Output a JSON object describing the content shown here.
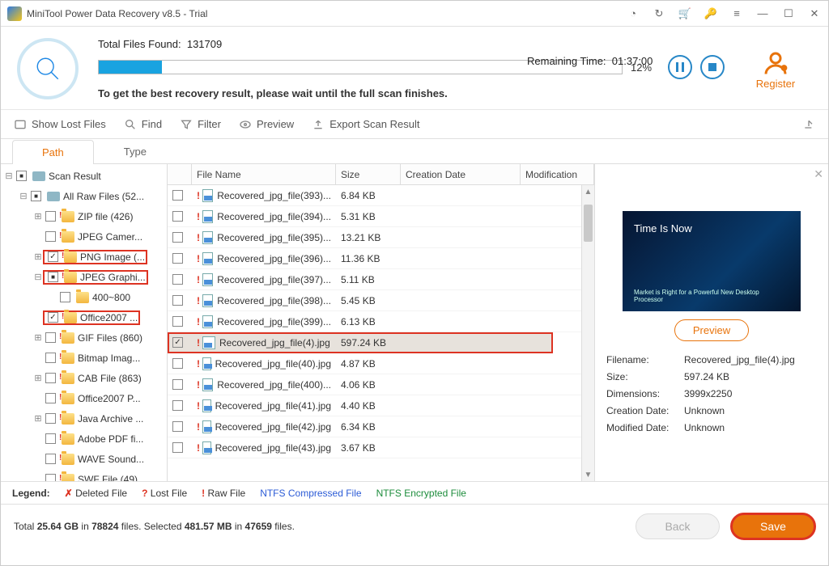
{
  "title": "MiniTool Power Data Recovery v8.5 - Trial",
  "scan": {
    "found_label": "Total Files Found:",
    "found_value": "131709",
    "remaining_label": "Remaining Time:",
    "remaining_value": "01:37:00",
    "percent": "12%",
    "hint_prefix": "To get the best recovery result, please wait until the full scan finishes."
  },
  "register_label": "Register",
  "toolbar": {
    "show_lost": "Show Lost Files",
    "find": "Find",
    "filter": "Filter",
    "preview": "Preview",
    "export": "Export Scan Result"
  },
  "tabs": {
    "path": "Path",
    "type": "Type"
  },
  "tree": [
    {
      "indent": 0,
      "exp": "⊟",
      "cb": "ind",
      "icon": "drive",
      "label": "Scan Result"
    },
    {
      "indent": 1,
      "exp": "⊟",
      "cb": "ind",
      "icon": "drive",
      "label": "All Raw Files (52..."
    },
    {
      "indent": 2,
      "exp": "⊞",
      "cb": "",
      "icon": "raw",
      "label": "ZIP file (426)"
    },
    {
      "indent": 2,
      "exp": "",
      "cb": "",
      "icon": "raw",
      "label": "JPEG Camer..."
    },
    {
      "indent": 2,
      "exp": "⊞",
      "cb": "chk",
      "icon": "raw",
      "label": "PNG Image (...",
      "hl": true
    },
    {
      "indent": 2,
      "exp": "⊟",
      "cb": "ind",
      "icon": "raw",
      "label": "JPEG Graphi...",
      "hl": true
    },
    {
      "indent": 3,
      "exp": "",
      "cb": "",
      "icon": "folder",
      "label": "400~800"
    },
    {
      "indent": 2,
      "exp": "",
      "cb": "chk",
      "icon": "raw",
      "label": "Office2007 ...",
      "hl": true
    },
    {
      "indent": 2,
      "exp": "⊞",
      "cb": "",
      "icon": "raw",
      "label": "GIF Files (860)"
    },
    {
      "indent": 2,
      "exp": "",
      "cb": "",
      "icon": "raw",
      "label": "Bitmap Imag..."
    },
    {
      "indent": 2,
      "exp": "⊞",
      "cb": "",
      "icon": "raw",
      "label": "CAB File (863)"
    },
    {
      "indent": 2,
      "exp": "",
      "cb": "",
      "icon": "raw",
      "label": "Office2007 P..."
    },
    {
      "indent": 2,
      "exp": "⊞",
      "cb": "",
      "icon": "raw",
      "label": "Java Archive ..."
    },
    {
      "indent": 2,
      "exp": "",
      "cb": "",
      "icon": "raw",
      "label": "Adobe PDF fi..."
    },
    {
      "indent": 2,
      "exp": "",
      "cb": "",
      "icon": "raw",
      "label": "WAVE Sound..."
    },
    {
      "indent": 2,
      "exp": "",
      "cb": "",
      "icon": "raw",
      "label": "SWF File (49)"
    }
  ],
  "columns": {
    "name": "File Name",
    "size": "Size",
    "cd": "Creation Date",
    "md": "Modification"
  },
  "files": [
    {
      "cb": "",
      "name": "Recovered_jpg_file(393)...",
      "size": "6.84 KB"
    },
    {
      "cb": "",
      "name": "Recovered_jpg_file(394)...",
      "size": "5.31 KB"
    },
    {
      "cb": "",
      "name": "Recovered_jpg_file(395)...",
      "size": "13.21 KB"
    },
    {
      "cb": "",
      "name": "Recovered_jpg_file(396)...",
      "size": "11.36 KB"
    },
    {
      "cb": "",
      "name": "Recovered_jpg_file(397)...",
      "size": "5.11 KB"
    },
    {
      "cb": "",
      "name": "Recovered_jpg_file(398)...",
      "size": "5.45 KB"
    },
    {
      "cb": "",
      "name": "Recovered_jpg_file(399)...",
      "size": "6.13 KB"
    },
    {
      "cb": "chk",
      "name": "Recovered_jpg_file(4).jpg",
      "size": "597.24 KB",
      "hl": true,
      "sel": true
    },
    {
      "cb": "",
      "name": "Recovered_jpg_file(40).jpg",
      "size": "4.87 KB"
    },
    {
      "cb": "",
      "name": "Recovered_jpg_file(400)...",
      "size": "4.06 KB"
    },
    {
      "cb": "",
      "name": "Recovered_jpg_file(41).jpg",
      "size": "4.40 KB"
    },
    {
      "cb": "",
      "name": "Recovered_jpg_file(42).jpg",
      "size": "6.34 KB"
    },
    {
      "cb": "",
      "name": "Recovered_jpg_file(43).jpg",
      "size": "3.67 KB"
    }
  ],
  "preview": {
    "img_title": "Time Is Now",
    "img_sub": "Market is Right for a Powerful New Desktop Processor",
    "btn": "Preview",
    "meta": [
      {
        "k": "Filename:",
        "v": "Recovered_jpg_file(4).jpg"
      },
      {
        "k": "Size:",
        "v": "597.24 KB"
      },
      {
        "k": "Dimensions:",
        "v": "3999x2250"
      },
      {
        "k": "Creation Date:",
        "v": "Unknown"
      },
      {
        "k": "Modified Date:",
        "v": "Unknown"
      }
    ]
  },
  "legend": {
    "label": "Legend:",
    "del": "Deleted File",
    "lost": "Lost File",
    "raw": "Raw File",
    "ntfs1": "NTFS Compressed File",
    "ntfs2": "NTFS Encrypted File"
  },
  "footer": {
    "status_1": "Total ",
    "status_2": "25.64 GB",
    "status_3": " in ",
    "status_4": "78824",
    "status_5": " files.  Selected ",
    "status_6": "481.57 MB",
    "status_7": " in ",
    "status_8": "47659",
    "status_9": " files.",
    "back": "Back",
    "save": "Save"
  }
}
